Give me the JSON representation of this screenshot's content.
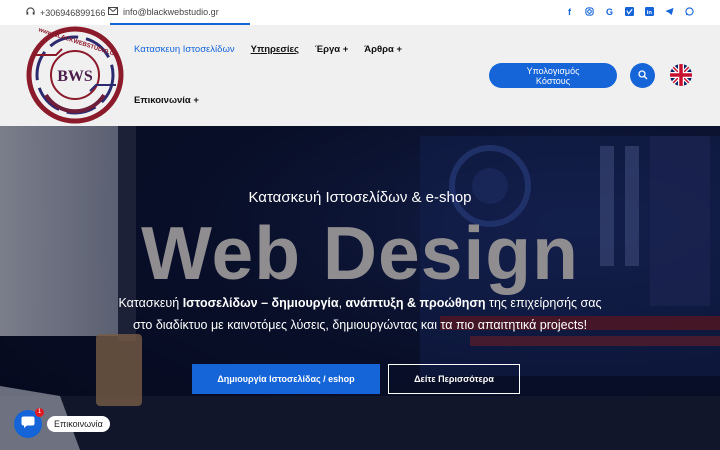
{
  "topbar": {
    "phone": "+306946899166",
    "email": "info@blackwebstudio.gr",
    "socials": [
      "facebook-icon",
      "instagram-icon",
      "google-icon",
      "vimeo-icon",
      "linkedin-icon",
      "telegram-icon",
      "whatsapp-icon"
    ]
  },
  "header": {
    "logo_text": "www.BLACKWEBSTUDIO.GR",
    "logo_mark": "BWS",
    "nav": {
      "item1": "Κατασκευη Ιστοσελίδων",
      "item2": "Υπηρεσίες",
      "item3": "Έργα +",
      "item4": "Άρθρα +",
      "item5": "Επικοινωνία +"
    },
    "cta_line1": "Υπολογισμός",
    "cta_line2": "Κόστους"
  },
  "hero": {
    "subtitle": "Κατασκευή Ιστοσελίδων & e-shop",
    "title": "Web Design",
    "text1_a": "Κατασκευή ",
    "text1_b": "Ιστοσελίδων – δημιουργία",
    "text1_c": ", ",
    "text1_d": "ανάπτυξη & προώθηση",
    "text1_e": " της επιχείρησής σας",
    "text2": "στο διαδίκτυο με καινοτόμες λύσεις, δημιουργώντας και τα πιο απαιτητικά projects!",
    "btn_primary": "Δημιουργία Ιστοσελίδας / eshop",
    "btn_secondary": "Δείτε Περισσότερα"
  },
  "chat": {
    "badge": "1",
    "label": "Επικοινωνία"
  },
  "colors": {
    "accent": "#1565d8",
    "hero_bg": "#0b1330",
    "title_gray": "#8f8d90"
  }
}
